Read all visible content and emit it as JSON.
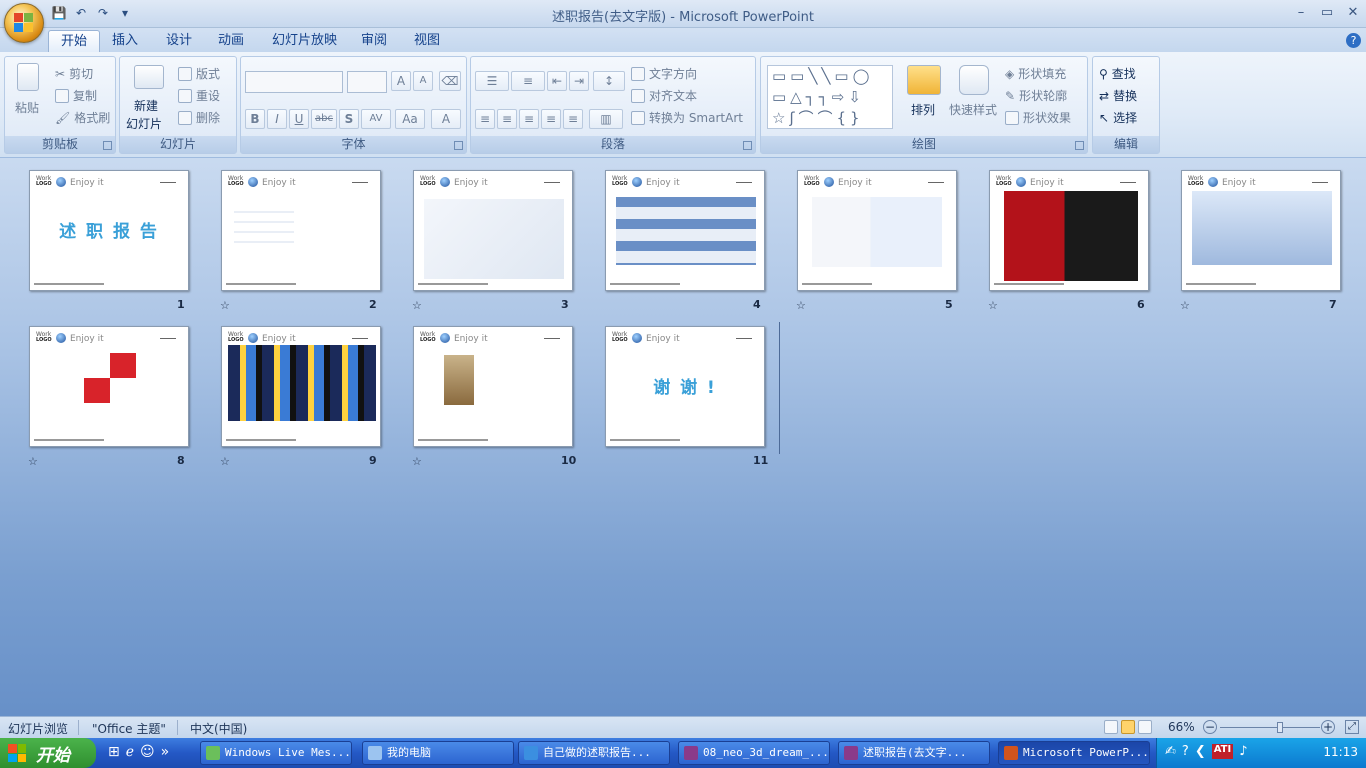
{
  "window": {
    "title": "述职报告(去文字版) - Microsoft PowerPoint",
    "minimize": "–",
    "maximize": "▭",
    "close": "✕"
  },
  "qat": [
    "save-icon",
    "undo-icon",
    "redo-icon",
    "customize-icon"
  ],
  "tabs": [
    {
      "label": "开始",
      "active": true
    },
    {
      "label": "插入"
    },
    {
      "label": "设计"
    },
    {
      "label": "动画"
    },
    {
      "label": "幻灯片放映"
    },
    {
      "label": "审阅"
    },
    {
      "label": "视图"
    }
  ],
  "ribbon": {
    "clipboard": {
      "label": "剪贴板",
      "paste": "粘贴",
      "cut": "剪切",
      "copy": "复制",
      "format_painter": "格式刷"
    },
    "slides": {
      "label": "幻灯片",
      "new_slide_line1": "新建",
      "new_slide_line2": "幻灯片",
      "layout": "版式",
      "reset": "重设",
      "delete": "删除"
    },
    "font": {
      "label": "字体",
      "bold": "B",
      "italic": "I",
      "underline": "U",
      "strike": "abc",
      "shadow": "S",
      "spacing": "AV",
      "case": "Aa",
      "color": "A",
      "grow": "A",
      "shrink": "A"
    },
    "paragraph": {
      "label": "段落",
      "text_direction": "文字方向",
      "align_text": "对齐文本",
      "smartart": "转换为 SmartArt"
    },
    "drawing": {
      "label": "绘图",
      "arrange": "排列",
      "quick_styles": "快速样式",
      "fill": "形状填充",
      "outline": "形状轮廓",
      "effects": "形状效果"
    },
    "editing": {
      "label": "编辑",
      "find": "查找",
      "replace": "替换",
      "select": "选择"
    }
  },
  "slides": [
    {
      "num": "1",
      "title": "述 职 报 告",
      "star": false
    },
    {
      "num": "2",
      "star": true
    },
    {
      "num": "3",
      "star": true
    },
    {
      "num": "4",
      "star": false
    },
    {
      "num": "5",
      "star": true
    },
    {
      "num": "6",
      "star": true
    },
    {
      "num": "7",
      "star": true
    },
    {
      "num": "8",
      "star": true
    },
    {
      "num": "9",
      "star": true
    },
    {
      "num": "10",
      "star": true
    },
    {
      "num": "11",
      "title": "谢 谢 !",
      "star": false
    }
  ],
  "slide_common": {
    "hdr": "Work",
    "logo": "LOGO",
    "enjoy": "Enjoy it",
    "star": "☆"
  },
  "status": {
    "view": "幻灯片浏览",
    "theme": "\"Office 主题\"",
    "lang": "中文(中国)",
    "zoom": "66%"
  },
  "taskbar": {
    "start": "开始",
    "buttons": [
      {
        "label": "Windows Live Mes..."
      },
      {
        "label": "我的电脑"
      },
      {
        "label": "自己做的述职报告..."
      },
      {
        "label": "08_neo_3d_dream_..."
      },
      {
        "label": "述职报告(去文字..."
      },
      {
        "label": "Microsoft PowerP..."
      }
    ],
    "clock": "11:13"
  }
}
